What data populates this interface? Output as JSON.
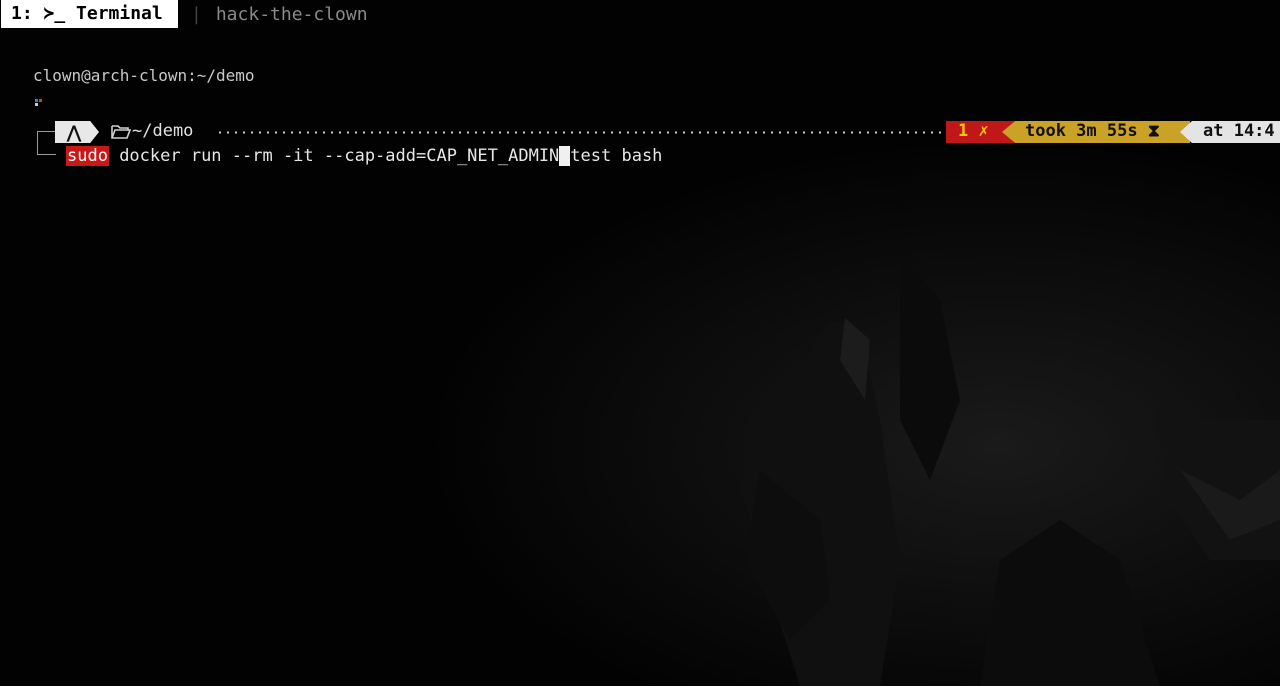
{
  "topbar": {
    "active_workspace": "1: ≻_ Terminal",
    "separator": "|",
    "inactive_workspace": "hack-the-clown"
  },
  "terminal": {
    "user_host_path": "clown@arch-clown:~/demo",
    "prompt": {
      "os_icon": "arch-linux-icon",
      "os_glyph": "⋀",
      "dir_icon": "folder-open-icon",
      "dir": "~/demo",
      "exit_status": "1 ✗",
      "took": "took 3m 55s ⧗",
      "time": "at 14:4"
    },
    "command": {
      "sudo": "sudo",
      "before_cursor": " docker run --rm -it --cap-add=CAP_NET_ADMIN",
      "after_cursor": "test bash"
    }
  },
  "colors": {
    "background": "#020202",
    "exit_segment": "#c01818",
    "exit_text": "#f1c40f",
    "took_segment": "#c9a227",
    "time_segment": "#e4e4e4",
    "sudo_highlight": "#c81818"
  }
}
